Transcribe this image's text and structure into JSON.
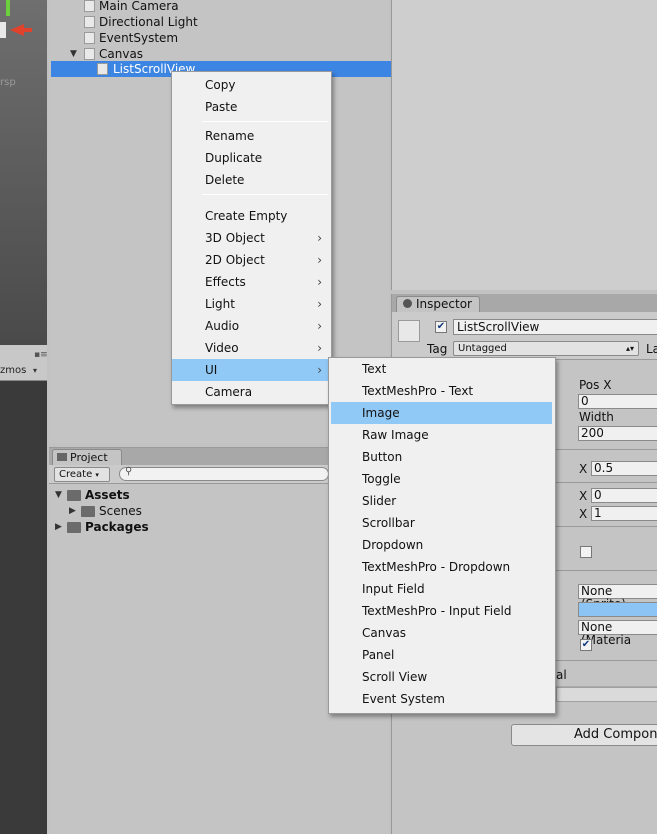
{
  "scene": {
    "persp_label": "rsp",
    "gizmos_label": "zmos"
  },
  "hierarchy": {
    "items": [
      {
        "label": "Main Camera"
      },
      {
        "label": "Directional Light"
      },
      {
        "label": "EventSystem"
      },
      {
        "label": "Canvas"
      },
      {
        "label": "ListScrollView"
      }
    ]
  },
  "context_menu": {
    "copy": "Copy",
    "paste": "Paste",
    "rename": "Rename",
    "duplicate": "Duplicate",
    "delete": "Delete",
    "create_empty": "Create Empty",
    "obj3d": "3D Object",
    "obj2d": "2D Object",
    "effects": "Effects",
    "light": "Light",
    "audio": "Audio",
    "video": "Video",
    "ui": "UI",
    "camera": "Camera"
  },
  "ui_submenu": {
    "items": [
      "Text",
      "TextMeshPro - Text",
      "Image",
      "Raw Image",
      "Button",
      "Toggle",
      "Slider",
      "Scrollbar",
      "Dropdown",
      "TextMeshPro - Dropdown",
      "Input Field",
      "TextMeshPro - Input Field",
      "Canvas",
      "Panel",
      "Scroll View",
      "Event System"
    ],
    "highlighted": "Image"
  },
  "project": {
    "tab_label": "Project",
    "create_label": "Create",
    "tree": [
      {
        "label": "Assets"
      },
      {
        "label": "Scenes"
      },
      {
        "label": "Packages"
      }
    ]
  },
  "inspector": {
    "tab_label": "Inspector",
    "object_name": "ListScrollView",
    "tag_label": "Tag",
    "tag_value": "Untagged",
    "layer_label": "La",
    "pos_x_label": "Pos X",
    "pos_x_value": "0",
    "width_label": "Width",
    "width_value": "200",
    "anchor_x_label_1": "X",
    "anchor_x_value_1": "0.5",
    "anchor_x_label_2": "X",
    "anchor_x_value_2": "0",
    "anchor_x_label_3": "X",
    "anchor_x_value_3": "1",
    "source_image": "None (Sprite)",
    "material": "None (Materia",
    "partial_label": "al",
    "add_component": "Add Compone",
    "color_swatch": "#8cc4f5"
  },
  "colors": {
    "selection": "#3d85e2",
    "menu_highlight": "#90c8f6"
  }
}
